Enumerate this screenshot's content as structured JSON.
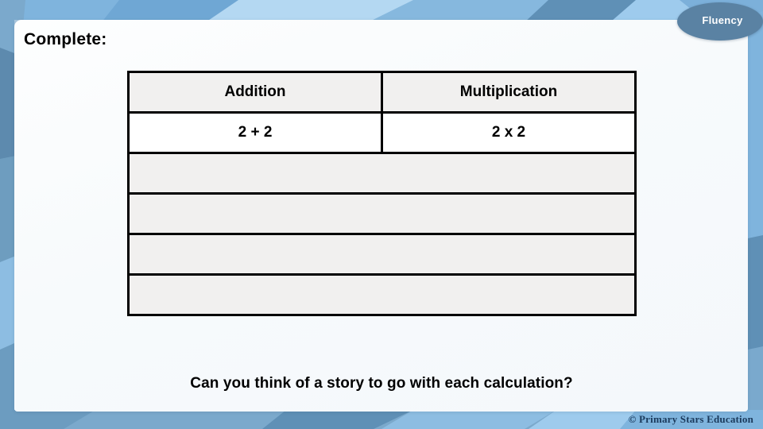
{
  "slide": {
    "title": "Complete:",
    "badge_label": "Fluency",
    "question": "Can you think of a story to go with each calculation?",
    "watermark": "© Primary Stars Education",
    "colors": {
      "background_blue": "#9ecbed",
      "accent_slate": "#5a82a3",
      "panel_white": "#f7fafc",
      "cell_gray": "#f1f0ef",
      "highlight_red": "#c00000",
      "border_black": "#000000",
      "watermark_navy": "#1b3a5c"
    }
  },
  "table": {
    "headers": [
      "Addition",
      "Multiplication"
    ],
    "rows": [
      {
        "type": "filled",
        "cells": [
          {
            "text": "2 + 2",
            "color": "black"
          },
          {
            "text": "2 x 2",
            "color": "red"
          }
        ]
      },
      {
        "type": "empty",
        "cells": [
          {
            "text": ""
          }
        ]
      },
      {
        "type": "empty",
        "cells": [
          {
            "text": ""
          }
        ]
      },
      {
        "type": "empty",
        "cells": [
          {
            "text": ""
          }
        ]
      },
      {
        "type": "empty",
        "cells": [
          {
            "text": ""
          }
        ]
      }
    ]
  }
}
